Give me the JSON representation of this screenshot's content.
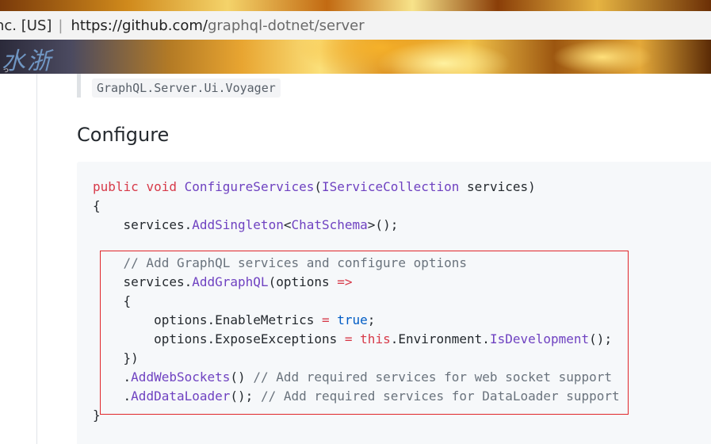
{
  "browser": {
    "ev_cert_text": "nc. [US]",
    "separator": "|",
    "url_host": "https://github.com/",
    "url_path": "graphql-dotnet/server"
  },
  "banner": {
    "mark_text": "水浙",
    "sub_text": "つ"
  },
  "content": {
    "inline_code": "GraphQL.Server.Ui.Voyager",
    "heading": "Configure"
  },
  "code_lines": [
    [
      {
        "t": "public",
        "c": "kw"
      },
      {
        "t": " "
      },
      {
        "t": "void",
        "c": "kw"
      },
      {
        "t": " "
      },
      {
        "t": "ConfigureServices",
        "c": "fn"
      },
      {
        "t": "("
      },
      {
        "t": "IServiceCollection",
        "c": "ty"
      },
      {
        "t": " services)"
      }
    ],
    [
      {
        "t": "{"
      }
    ],
    [
      {
        "t": "    services."
      },
      {
        "t": "AddSingleton",
        "c": "fn"
      },
      {
        "t": "<"
      },
      {
        "t": "ChatSchema",
        "c": "ty"
      },
      {
        "t": ">();"
      }
    ],
    [
      {
        "t": ""
      }
    ],
    [
      {
        "t": "    "
      },
      {
        "t": "// Add GraphQL services and configure options",
        "c": "cm"
      }
    ],
    [
      {
        "t": "    services."
      },
      {
        "t": "AddGraphQL",
        "c": "fn"
      },
      {
        "t": "(options "
      },
      {
        "t": "=>",
        "c": "op"
      }
    ],
    [
      {
        "t": "    {"
      }
    ],
    [
      {
        "t": "        options.EnableMetrics "
      },
      {
        "t": "=",
        "c": "op"
      },
      {
        "t": " "
      },
      {
        "t": "true",
        "c": "lit"
      },
      {
        "t": ";"
      }
    ],
    [
      {
        "t": "        options.ExposeExceptions "
      },
      {
        "t": "=",
        "c": "op"
      },
      {
        "t": " "
      },
      {
        "t": "this",
        "c": "kw"
      },
      {
        "t": ".Environment."
      },
      {
        "t": "IsDevelopment",
        "c": "fn"
      },
      {
        "t": "();"
      }
    ],
    [
      {
        "t": "    })"
      }
    ],
    [
      {
        "t": "    ."
      },
      {
        "t": "AddWebSockets",
        "c": "fn"
      },
      {
        "t": "() "
      },
      {
        "t": "// Add required services for web socket support",
        "c": "cm"
      }
    ],
    [
      {
        "t": "    ."
      },
      {
        "t": "AddDataLoader",
        "c": "fn"
      },
      {
        "t": "(); "
      },
      {
        "t": "// Add required services for DataLoader support",
        "c": "cm"
      }
    ],
    [
      {
        "t": "}"
      }
    ]
  ],
  "colors": {
    "keyword": "#d73a49",
    "function": "#6f42c1",
    "comment": "#6a737d",
    "literal": "#005cc5",
    "annotation_box": "#e0262a"
  }
}
